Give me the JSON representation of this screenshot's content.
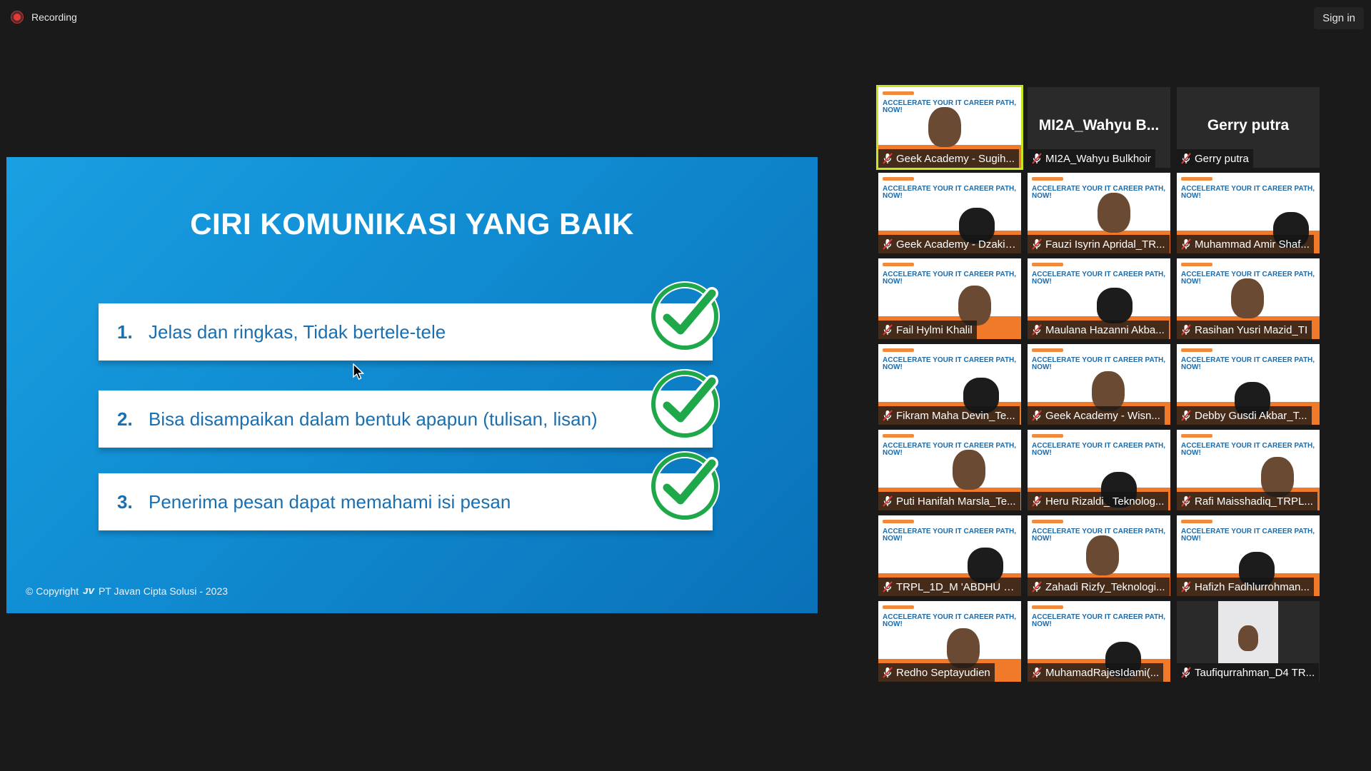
{
  "topbar": {
    "recording_label": "Recording",
    "signin_label": "Sign in"
  },
  "slide": {
    "title": "CIRI KOMUNIKASI YANG BAIK",
    "points": [
      {
        "num": "1.",
        "text": "Jelas dan ringkas, Tidak bertele-tele"
      },
      {
        "num": "2.",
        "text": "Bisa disampaikan dalam bentuk apapun (tulisan, lisan)"
      },
      {
        "num": "3.",
        "text": "Penerima pesan dapat memahami isi pesan"
      }
    ],
    "copyright": "© Copyright",
    "company": "PT Javan Cipta Solusi - 2023"
  },
  "participants": [
    {
      "name": "Geek Academy - Sugih...",
      "video": true,
      "active": true
    },
    {
      "name": "MI2A_Wahyu Bulkhoir",
      "video": false,
      "big": "MI2A_Wahyu  B..."
    },
    {
      "name": "Gerry putra",
      "video": false,
      "big": "Gerry putra"
    },
    {
      "name": "Geek Academy - Dzaki ...",
      "video": true
    },
    {
      "name": "Fauzi Isyrin Apridal_TR...",
      "video": true
    },
    {
      "name": "Muhammad Amir Shaf...",
      "video": true
    },
    {
      "name": "Fail Hylmi Khalil",
      "video": true
    },
    {
      "name": "Maulana Hazanni Akba...",
      "video": true
    },
    {
      "name": "Rasihan Yusri Mazid_TI",
      "video": true
    },
    {
      "name": "Fikram Maha Devin_Te...",
      "video": true
    },
    {
      "name": "Geek Academy - Wisn...",
      "video": true
    },
    {
      "name": "Debby Gusdi Akbar_T...",
      "video": true
    },
    {
      "name": "Puti Hanifah Marsla_Te...",
      "video": true
    },
    {
      "name": "Heru Rizaldi_ Teknolog...",
      "video": true
    },
    {
      "name": "Rafi Maisshadiq_TRPL...",
      "video": true
    },
    {
      "name": "TRPL_1D_M 'ABDHU S...",
      "video": true
    },
    {
      "name": "Zahadi Rizfy_Teknologi...",
      "video": true
    },
    {
      "name": "Hafizh Fadhlurrohman...",
      "video": true
    },
    {
      "name": "Redho Septayudien",
      "video": true
    },
    {
      "name": "MuhamadRajesIdami(...",
      "video": true
    },
    {
      "name": "Taufiqurrahman_D4 TR...",
      "video": true,
      "photo": true
    }
  ],
  "background_text": "ACCELERATE YOUR IT CAREER PATH, NOW!",
  "colors": {
    "accent_active": "#c7e61f",
    "slide_blue": "#108bd1",
    "check_green": "#1fa84a"
  }
}
